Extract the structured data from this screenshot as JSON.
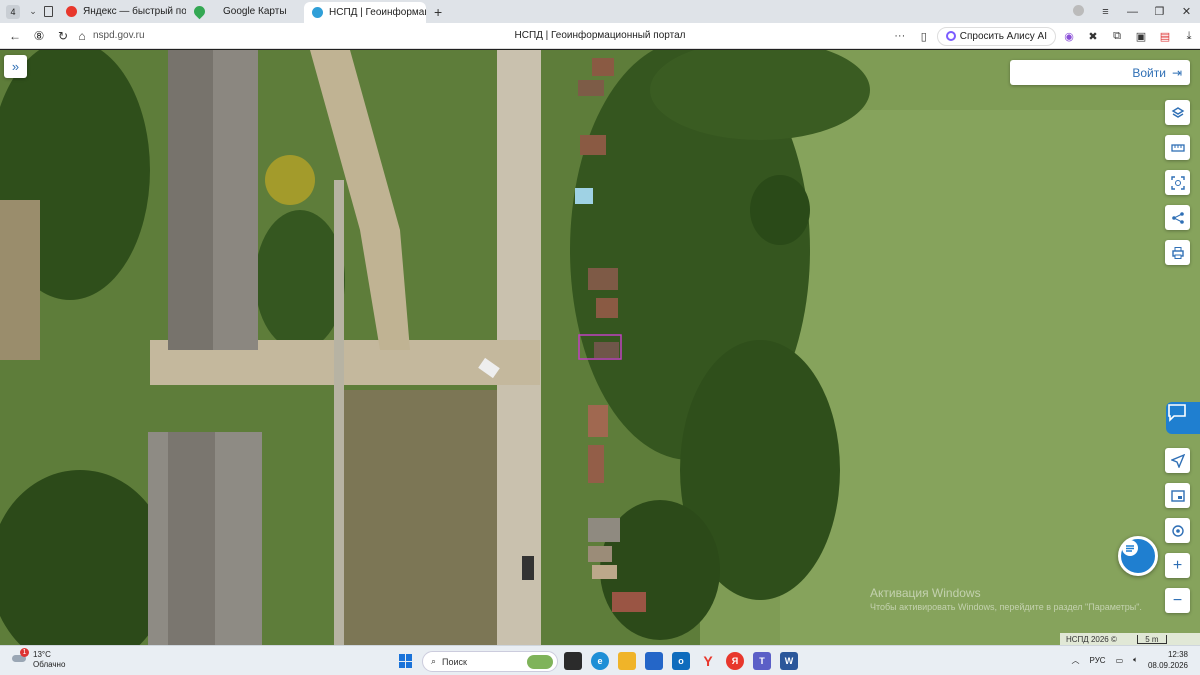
{
  "browser": {
    "tab_count": "4",
    "tabs": [
      {
        "label": "Яндекс — быстрый поиск",
        "favicon_color": "#e8372c"
      },
      {
        "label": "Google Карты",
        "favicon_color": "#34a853"
      },
      {
        "label": "НСПД | Геоинформаци",
        "favicon_color": "#2f9fd8",
        "active": true
      }
    ],
    "url": "nspd.gov.ru",
    "page_title": "НСПД | Геоинформационный портал",
    "alice_label": "Спросить Алису AI"
  },
  "map": {
    "login_label": "Войти",
    "watermark_title": "Активация Windows",
    "watermark_text": "Чтобы активировать Windows, перейдите в раздел \"Параметры\".",
    "copyright": "НСПД 2026 ©",
    "scale_label": "5 m",
    "selection_color": "#c040c0"
  },
  "taskbar": {
    "temperature": "13°C",
    "weather_desc": "Облачно",
    "weather_badge": "1",
    "search_placeholder": "Поиск",
    "language": "РУС",
    "time": "12:38",
    "date": "08.09.2026"
  }
}
